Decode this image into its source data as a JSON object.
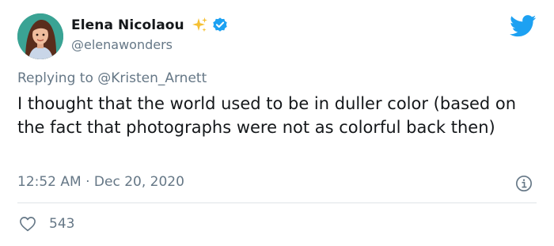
{
  "author": {
    "display_name": "Elena Nicolaou",
    "handle": "@elenawonders",
    "badge_icons": [
      "sparkles-icon",
      "verified-badge-icon"
    ]
  },
  "reply": {
    "prefix": "Replying to ",
    "mention": "@Kristen_Arnett"
  },
  "tweet": {
    "text": "I thought that the world used to be in duller color (based on the fact that photographs were not as colorful back then)",
    "timestamp": "12:52 AM · Dec 20, 2020"
  },
  "engagement": {
    "likes": "543"
  },
  "icons": {
    "brand": "twitter-bird-icon",
    "info": "info-icon",
    "like": "heart-icon"
  },
  "colors": {
    "brand_blue": "#1da1f2",
    "verified_blue": "#1da1f2",
    "sparkle_gold": "#f5c033",
    "muted_text": "#657786",
    "primary_text": "#14171a"
  }
}
